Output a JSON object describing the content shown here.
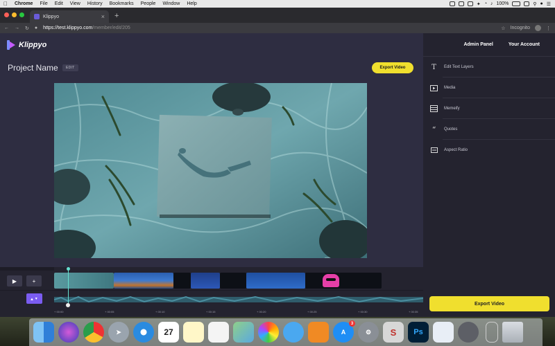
{
  "menubar": {
    "items": [
      "Chrome",
      "File",
      "Edit",
      "View",
      "History",
      "Bookmarks",
      "People",
      "Window",
      "Help"
    ],
    "battery": "100%",
    "clock": ""
  },
  "browser": {
    "tab_title": "Klippyo",
    "url_host": "https://test.klippyo.com",
    "url_path": "/member/edit/205",
    "incognito_label": "Incognito"
  },
  "app": {
    "logo_text": "Klippyo",
    "project_name": "Project Name",
    "edit_chip": "EDIT",
    "export_top": "Export Video",
    "export_bottom": "Export Video",
    "nav": {
      "admin_panel": "Admin Panel",
      "your_account": "Your Account"
    },
    "tools": [
      {
        "label": "Edit Text Layers",
        "icon": "text-icon"
      },
      {
        "label": "Media",
        "icon": "media-icon"
      },
      {
        "label": "Memeify",
        "icon": "memeify-icon"
      },
      {
        "label": "Quotes",
        "icon": "quote-icon"
      },
      {
        "label": "Aspect Ratio",
        "icon": "aspect-ratio-icon"
      }
    ]
  },
  "timeline": {
    "ticks": [
      "00:00",
      "00:05",
      "00:10",
      "00:15",
      "00:20",
      "00:25",
      "00:30",
      "00:35"
    ],
    "playhead_seconds": 0
  },
  "colors": {
    "accent_yellow": "#f0df2e",
    "volume_purple": "#7a5cf0",
    "panel_bg": "#24232f",
    "main_bg": "#2e2d41"
  }
}
